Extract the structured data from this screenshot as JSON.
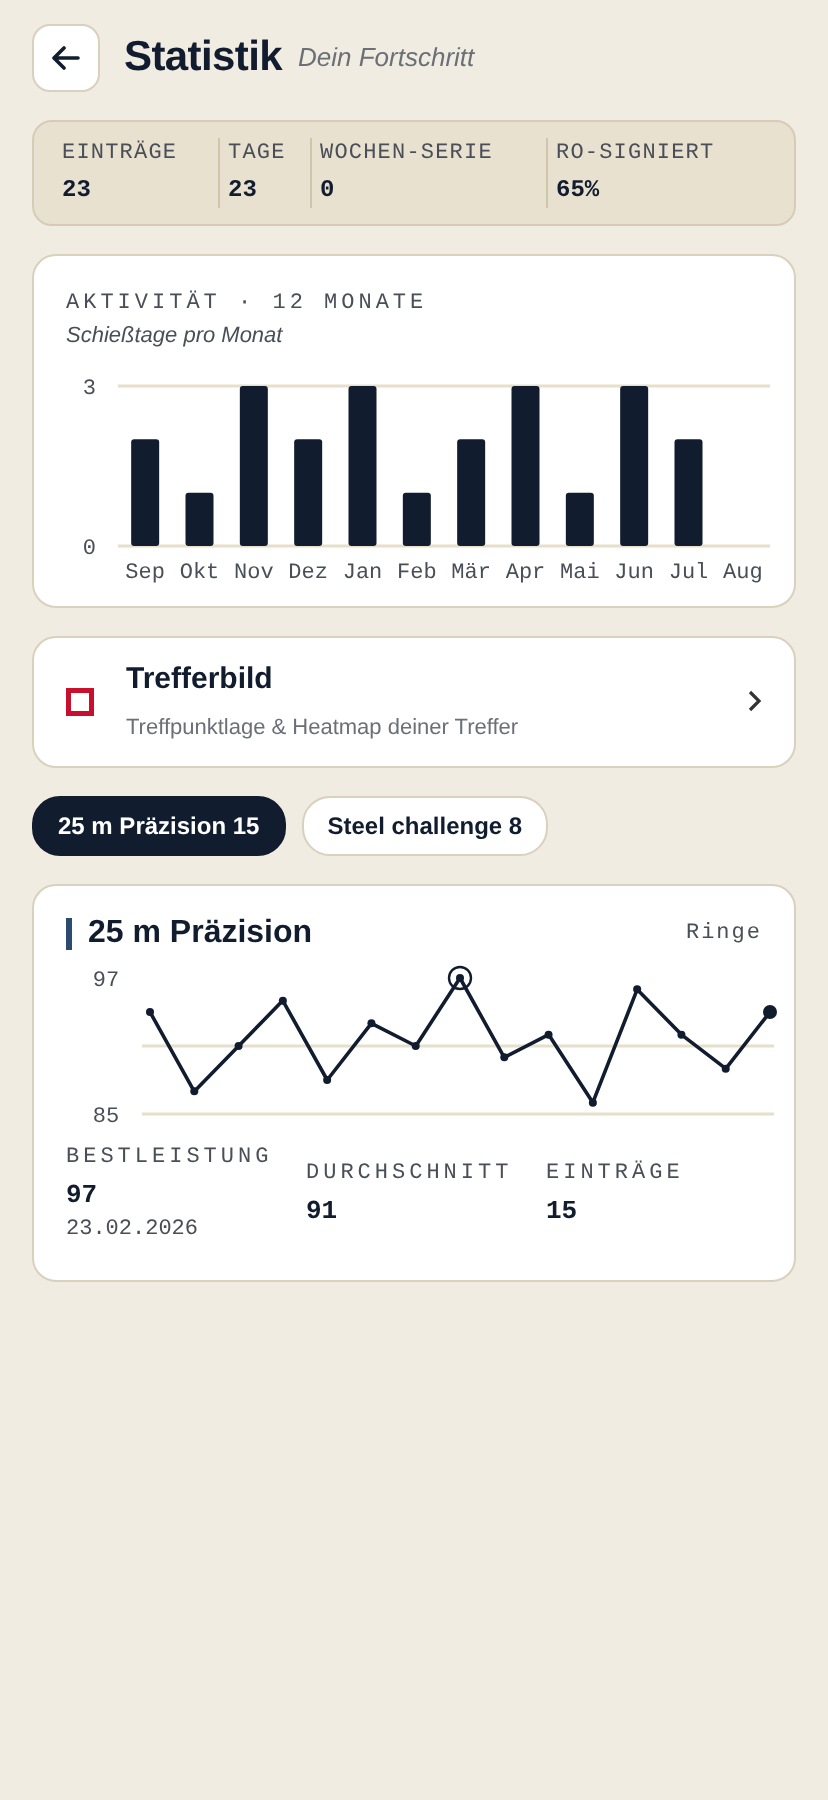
{
  "header": {
    "title": "Statistik",
    "subtitle": "Dein Fortschritt"
  },
  "summary": [
    {
      "label": "EINTRÄGE",
      "value": "23"
    },
    {
      "label": "TAGE",
      "value": "23"
    },
    {
      "label": "WOCHEN-SERIE",
      "value": "0"
    },
    {
      "label": "RO-SIGNIERT",
      "value": "65%"
    }
  ],
  "activity": {
    "title": "AKTIVITÄT · 12 MONATE",
    "subtitle": "Schießtage pro Monat",
    "chart_data": {
      "type": "bar",
      "categories": [
        "Sep",
        "Okt",
        "Nov",
        "Dez",
        "Jan",
        "Feb",
        "Mär",
        "Apr",
        "Mai",
        "Jun",
        "Jul",
        "Aug"
      ],
      "series": [
        {
          "color": "#111c2e",
          "values": [
            2,
            1,
            3,
            2,
            3,
            1,
            2,
            3,
            1,
            3,
            2,
            0
          ]
        }
      ],
      "ylim": [
        0,
        3
      ],
      "yticks": [
        0,
        3
      ]
    }
  },
  "link_card": {
    "title": "Trefferbild",
    "subtitle": "Treffpunktlage & Heatmap deiner Treffer"
  },
  "filters": [
    {
      "label": "25 m Präzision",
      "count": "15",
      "selected": true
    },
    {
      "label": "Steel challenge",
      "count": "8",
      "selected": false
    }
  ],
  "discipline": {
    "title": "25 m Präzision",
    "unit": "Ringe",
    "chart_data": {
      "type": "line",
      "series": [
        {
          "color": "#111c2e",
          "marker": "o",
          "values": [
            94,
            87,
            91,
            95,
            88,
            93,
            91,
            97,
            90,
            92,
            86,
            96,
            92,
            89,
            94
          ]
        }
      ],
      "ylim": [
        85,
        97
      ],
      "yticks": [
        85,
        97
      ],
      "ref_lines": [
        {
          "axis": "y",
          "value": 91
        }
      ]
    },
    "stats": [
      {
        "label": "BESTLEISTUNG",
        "value": "97",
        "note": "23.02.2026"
      },
      {
        "label": "DURCHSCHNITT",
        "value": "91"
      },
      {
        "label": "EINTRÄGE",
        "value": "15"
      }
    ]
  }
}
